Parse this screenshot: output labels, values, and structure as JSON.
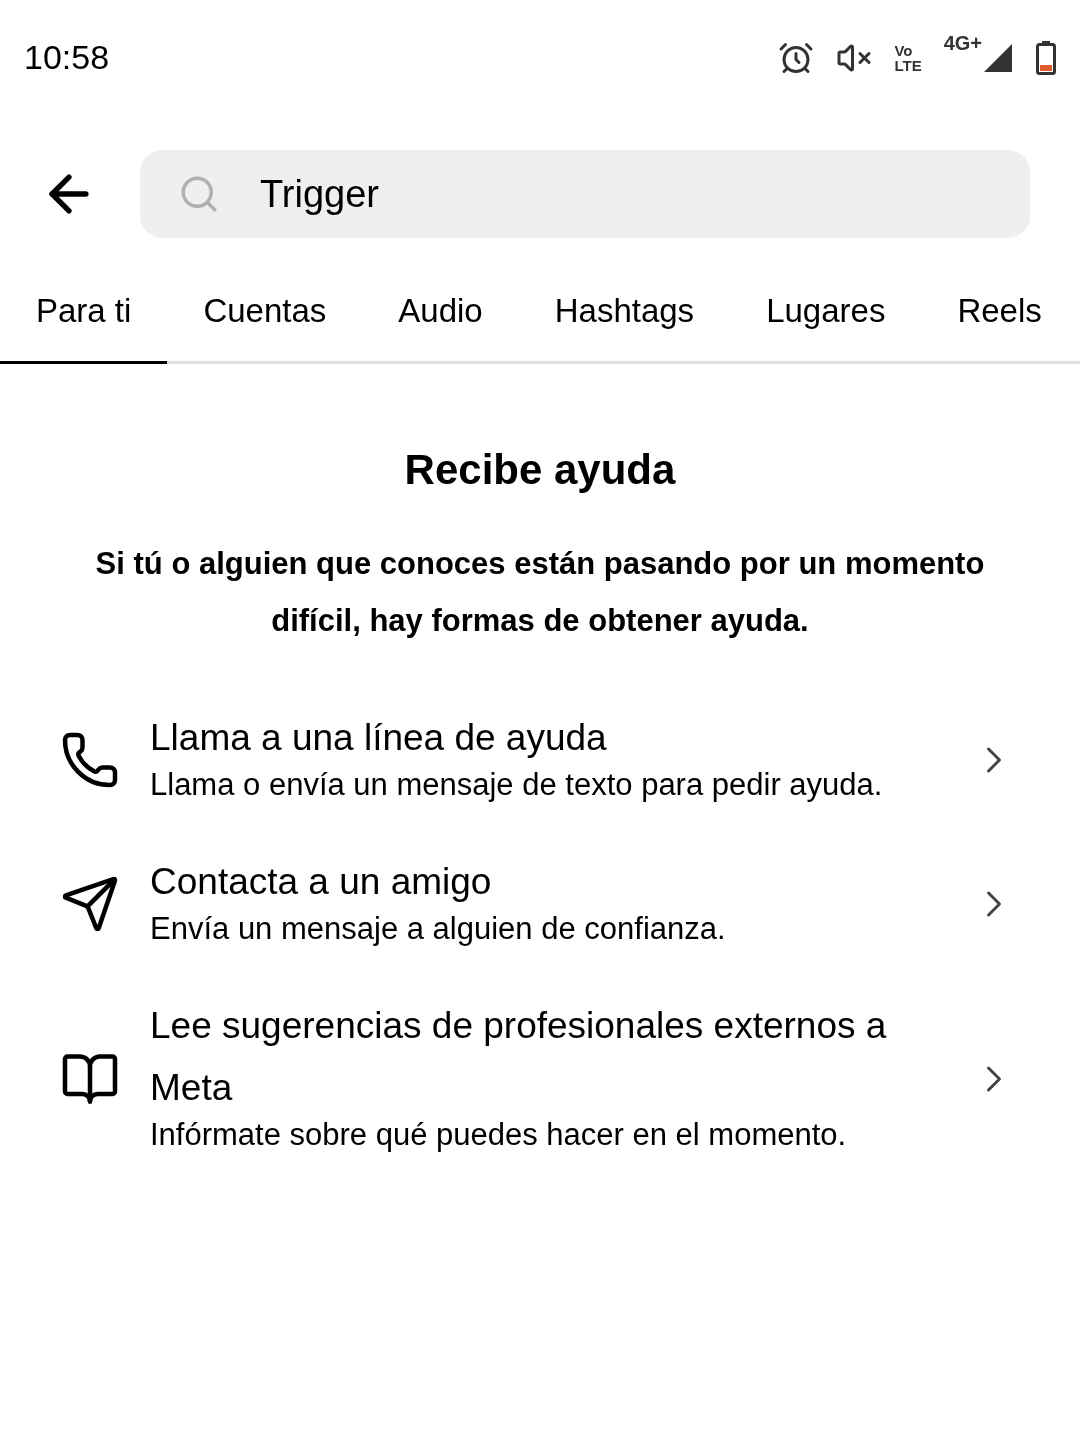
{
  "status_bar": {
    "time": "10:58",
    "volte_top": "Vo",
    "volte_bottom": "LTE",
    "network": "4G+"
  },
  "search": {
    "value": "Trigger"
  },
  "tabs": [
    {
      "label": "Para ti",
      "selected": true
    },
    {
      "label": "Cuentas",
      "selected": false
    },
    {
      "label": "Audio",
      "selected": false
    },
    {
      "label": "Hashtags",
      "selected": false
    },
    {
      "label": "Lugares",
      "selected": false
    },
    {
      "label": "Reels",
      "selected": false
    }
  ],
  "help": {
    "title": "Recibe ayuda",
    "subtitle": "Si tú o alguien que conoces están pasando por un momento difícil, hay formas de obtener ayuda.",
    "items": [
      {
        "kind": "phone",
        "title": "Llama a una línea de ayuda",
        "description": "Llama o envía un mensaje de texto para pedir ayuda."
      },
      {
        "kind": "send",
        "title": "Contacta a un amigo",
        "description": "Envía un mensaje a alguien de confianza."
      },
      {
        "kind": "book",
        "title": "Lee sugerencias de profesionales externos a Meta",
        "description": "Infórmate sobre qué puedes hacer en el momento."
      }
    ]
  }
}
